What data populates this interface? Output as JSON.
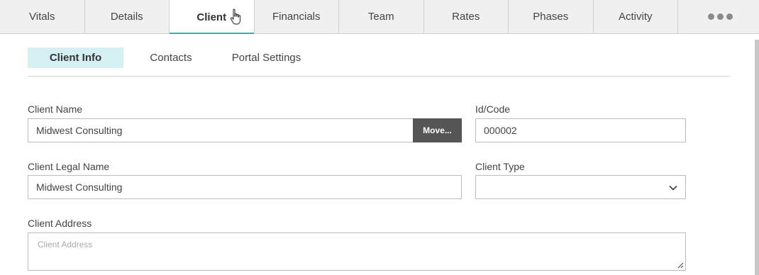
{
  "tabs": [
    {
      "label": "Vitals"
    },
    {
      "label": "Details"
    },
    {
      "label": "Client"
    },
    {
      "label": "Financials"
    },
    {
      "label": "Team"
    },
    {
      "label": "Rates"
    },
    {
      "label": "Phases"
    },
    {
      "label": "Activity"
    }
  ],
  "active_tab": "Client",
  "more_icon": "more-dots-icon",
  "subtabs": [
    {
      "label": "Client Info"
    },
    {
      "label": "Contacts"
    },
    {
      "label": "Portal Settings"
    }
  ],
  "form": {
    "client_name": {
      "label": "Client Name",
      "value": "Midwest Consulting"
    },
    "move_button": "Move...",
    "id_code": {
      "label": "Id/Code",
      "value": "000002"
    },
    "client_legal_name": {
      "label": "Client Legal Name",
      "value": "Midwest Consulting"
    },
    "client_type": {
      "label": "Client Type",
      "value": ""
    },
    "client_address": {
      "label": "Client Address",
      "placeholder": "Client Address"
    }
  },
  "colors": {
    "accent": "#2bb3b3",
    "subtab_active_bg": "#d4f0f3",
    "button_bg": "#555555"
  }
}
